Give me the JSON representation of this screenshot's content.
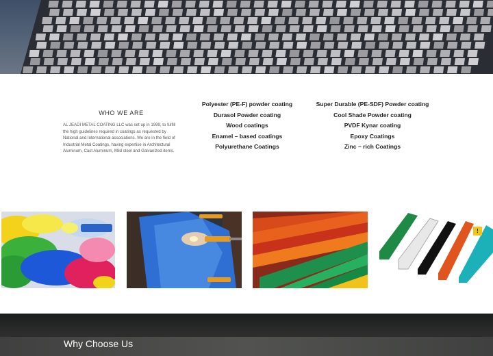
{
  "hero": {
    "image": "modern-building-facade-photo"
  },
  "about": {
    "title": "WHO WE ARE",
    "text": "AL JEADI METAL COATING LLC was set up in 1999, to fulfill the high guidelines required in coatings as requested by National and International associations. We are in the field of Industrial Metal Coatings, having expertise in Architectural Aluminum, Cast Aluminum, Mild steel and Galvanized items."
  },
  "coatings": {
    "column1": [
      "Polyester (PE-F) powder coating",
      "Durasol Powder coating",
      "Wood coatings",
      "Enamel – based coatings",
      "Polyurethane Coatings"
    ],
    "column2": [
      "Super Durable (PE-SDF) Powder coating",
      "Cool Shade Powder coating",
      "PVDF Kynar coating",
      "Epoxy Coatings",
      "Zinc – rich Coatings"
    ]
  },
  "gallery": {
    "images": [
      "colored-powder-photo",
      "spray-coating-booth-photo",
      "colored-profiles-photo",
      "aluminum-profiles-photo"
    ],
    "badge": "!"
  },
  "why": {
    "title": "Why Choose Us"
  },
  "colors": {
    "accent": "#f0c419",
    "dark": "#2a2b2a"
  }
}
